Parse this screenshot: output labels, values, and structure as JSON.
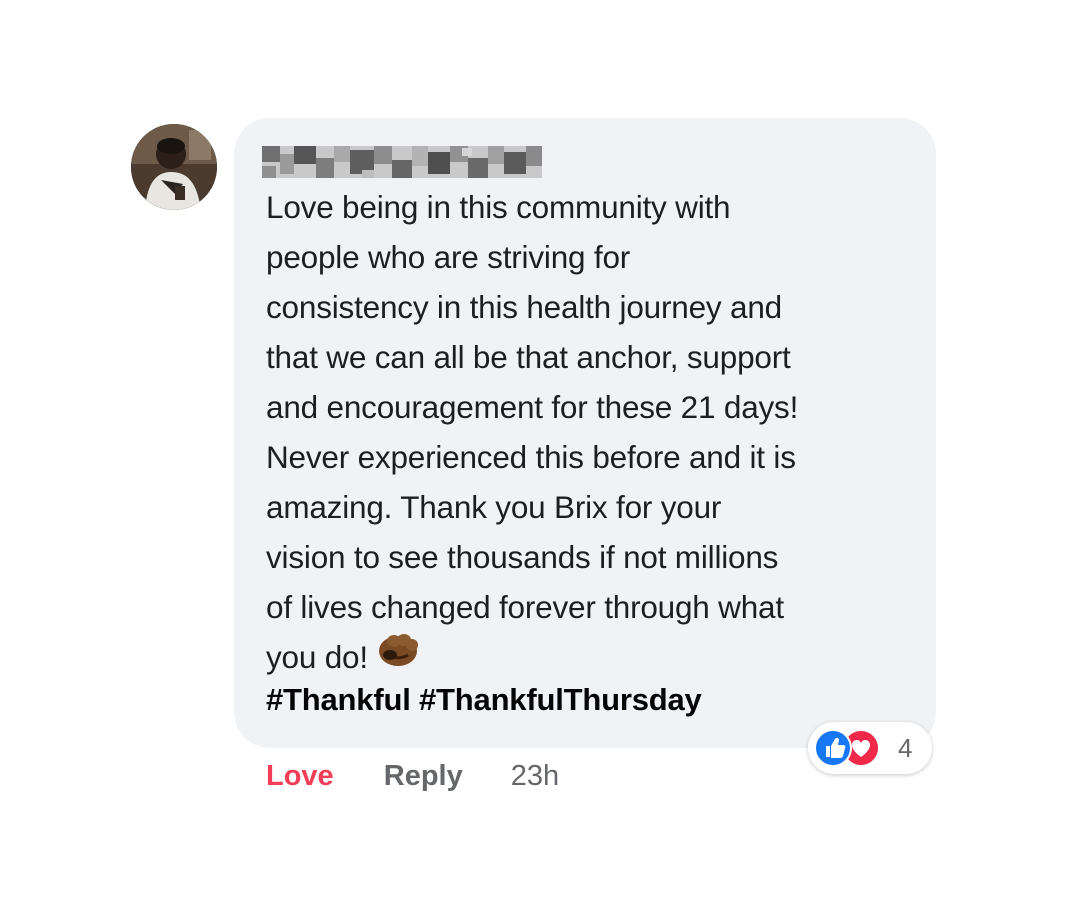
{
  "comment": {
    "author": {
      "name": "",
      "avatar_icon": "profile-photo"
    },
    "body_lines": [
      "Love being in this community with",
      "people who are striving for",
      "consistency in this health journey and",
      "that we can all be that anchor, support",
      "and encouragement for these 21 days!",
      "Never experienced this before and it is",
      "amazing. Thank you Brix for your",
      "vision to see thousands if not millions",
      "of lives changed forever through what",
      "you do!"
    ],
    "emoji_icon": "fist-bump-medium-dark-skin-tone",
    "hashtags": "#Thankful #ThankfulThursday",
    "reactions": {
      "types": [
        "like",
        "love"
      ],
      "count": "4"
    },
    "actions": {
      "love_label": "Love",
      "reply_label": "Reply",
      "timestamp": "23h"
    }
  },
  "colors": {
    "bubble_bg": "#f0f2f5",
    "love_active": "#f33e58",
    "secondary_text": "#65676b",
    "like_blue": "#1877f2",
    "love_red": "#f02849"
  }
}
